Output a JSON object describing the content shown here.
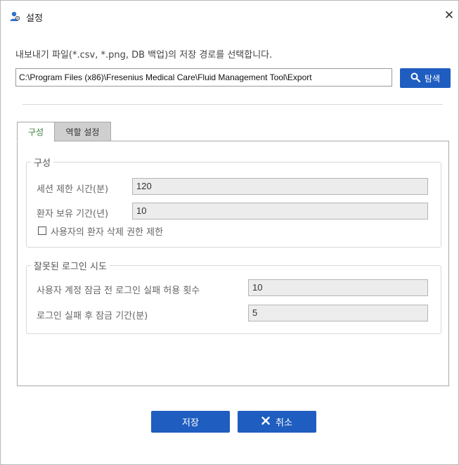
{
  "window": {
    "title": "설정",
    "close_icon": "close-icon",
    "app_icon": "user-settings-icon"
  },
  "export": {
    "prompt": "내보내기 파일(*.csv, *.png, DB 백업)의 저장 경로를 선택합니다.",
    "path": "C:\\Program Files (x86)\\Fresenius Medical Care\\Fluid Management Tool\\Export",
    "browse_label": "탐색",
    "browse_icon": "search-icon"
  },
  "tabs": [
    {
      "label": "구성",
      "active": true
    },
    {
      "label": "역할 설정",
      "active": false
    }
  ],
  "config_group": {
    "title": "구성",
    "session_limit_label": "세션 제한 시간(분)",
    "session_limit_value": "120",
    "retention_label": "환자 보유 기간(년)",
    "retention_value": "10",
    "restrict_delete_label": "사용자의 환자 삭제 권한 제한",
    "restrict_delete_checked": false
  },
  "login_group": {
    "title": "잘못된 로그인 시도",
    "attempts_label": "사용자 계정 잠금 전 로그인 실패 허용 횟수",
    "attempts_value": "10",
    "lock_label": "로그인 실패 후 잠금 기간(분)",
    "lock_value": "5"
  },
  "footer": {
    "save_label": "저장",
    "cancel_label": "취소",
    "cancel_icon": "x-icon"
  },
  "colors": {
    "primary": "#1f5dc0",
    "active_tab_text": "#3a7d3a",
    "inactive_tab_bg": "#cfcfcf",
    "field_bg": "#ececec"
  }
}
